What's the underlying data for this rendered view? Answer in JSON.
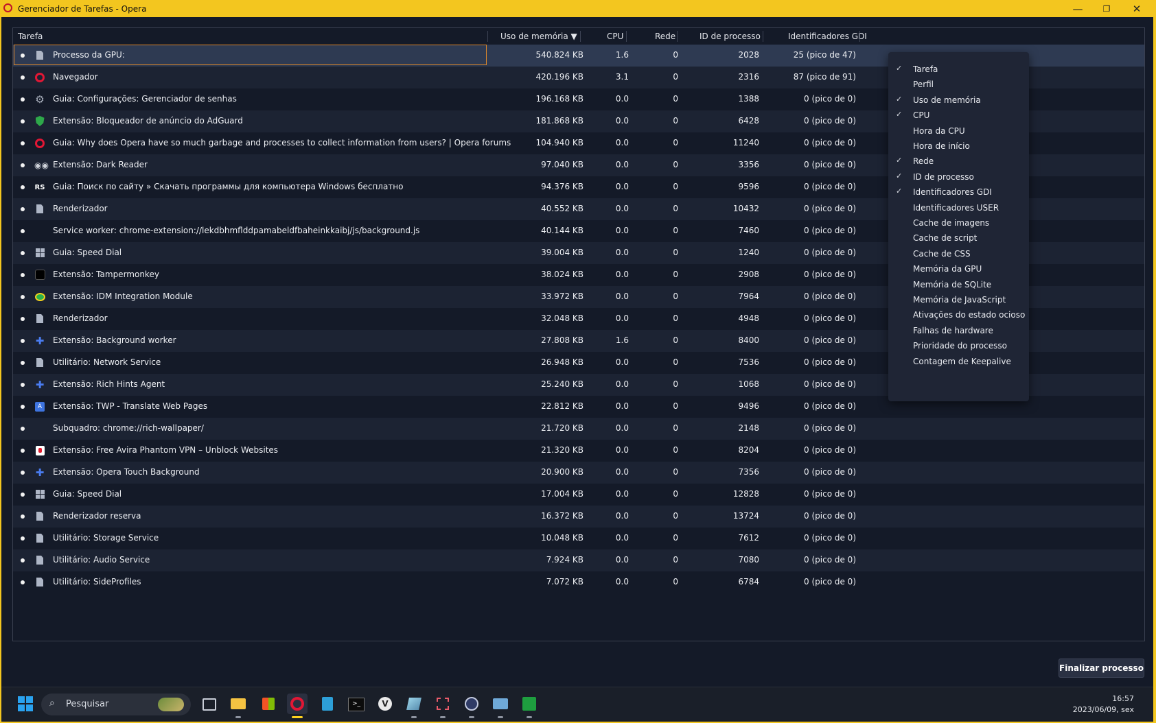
{
  "window": {
    "title": "Gerenciador de Tarefas - Opera",
    "controls": [
      "—",
      "❐",
      "✕"
    ]
  },
  "table": {
    "headers": {
      "task": "Tarefa",
      "memory": "Uso de memória ▼",
      "cpu": "CPU",
      "network": "Rede",
      "pid": "ID de processo",
      "gdi": "Identificadores GDI"
    },
    "rows": [
      {
        "icon": "doc-icon",
        "name": "Processo da GPU:",
        "mem": "540.824 KB",
        "cpu": "1.6",
        "net": "0",
        "pid": "2028",
        "gdi": "25 (pico de 47)",
        "selected": true
      },
      {
        "icon": "opera-icon",
        "name": "Navegador",
        "mem": "420.196 KB",
        "cpu": "3.1",
        "net": "0",
        "pid": "2316",
        "gdi": "87 (pico de 91)"
      },
      {
        "icon": "gear-icon",
        "name": "Guia: Configurações: Gerenciador de senhas",
        "mem": "196.168 KB",
        "cpu": "0.0",
        "net": "0",
        "pid": "1388",
        "gdi": "0 (pico de 0)"
      },
      {
        "icon": "shield-icon",
        "name": "Extensão: Bloqueador de anúncio do AdGuard",
        "mem": "181.868 KB",
        "cpu": "0.0",
        "net": "0",
        "pid": "6428",
        "gdi": "0 (pico de 0)"
      },
      {
        "icon": "opera-icon",
        "name": "Guia: Why does Opera have so much garbage and processes to collect information from users? | Opera forums",
        "mem": "104.940 KB",
        "cpu": "0.0",
        "net": "0",
        "pid": "11240",
        "gdi": "0 (pico de 0)"
      },
      {
        "icon": "dark-reader-icon",
        "name": "Extensão: Dark Reader",
        "mem": "97.040 KB",
        "cpu": "0.0",
        "net": "0",
        "pid": "3356",
        "gdi": "0 (pico de 0)"
      },
      {
        "icon": "rs-icon",
        "name": "Guia: Поиск по сайту » Скачать программы для компьютера Windows бесплатно",
        "mem": "94.376 KB",
        "cpu": "0.0",
        "net": "0",
        "pid": "9596",
        "gdi": "0 (pico de 0)"
      },
      {
        "icon": "doc-icon",
        "name": "Renderizador",
        "mem": "40.552 KB",
        "cpu": "0.0",
        "net": "0",
        "pid": "10432",
        "gdi": "0 (pico de 0)"
      },
      {
        "icon": "none",
        "name": "Service worker: chrome-extension://lekdbhmflddpamabeldfbaheinkkaibj/js/background.js",
        "mem": "40.144 KB",
        "cpu": "0.0",
        "net": "0",
        "pid": "7460",
        "gdi": "0 (pico de 0)"
      },
      {
        "icon": "grid-icon",
        "name": "Guia: Speed Dial",
        "mem": "39.004 KB",
        "cpu": "0.0",
        "net": "0",
        "pid": "1240",
        "gdi": "0 (pico de 0)"
      },
      {
        "icon": "tampermonkey-icon",
        "name": "Extensão: Tampermonkey",
        "mem": "38.024 KB",
        "cpu": "0.0",
        "net": "0",
        "pid": "2908",
        "gdi": "0 (pico de 0)"
      },
      {
        "icon": "idm-icon",
        "name": "Extensão: IDM Integration Module",
        "mem": "33.972 KB",
        "cpu": "0.0",
        "net": "0",
        "pid": "7964",
        "gdi": "0 (pico de 0)"
      },
      {
        "icon": "doc-icon",
        "name": "Renderizador",
        "mem": "32.048 KB",
        "cpu": "0.0",
        "net": "0",
        "pid": "4948",
        "gdi": "0 (pico de 0)"
      },
      {
        "icon": "puzzle-icon",
        "name": "Extensão: Background worker",
        "mem": "27.808 KB",
        "cpu": "1.6",
        "net": "0",
        "pid": "8400",
        "gdi": "0 (pico de 0)"
      },
      {
        "icon": "doc-icon",
        "name": "Utilitário: Network Service",
        "mem": "26.948 KB",
        "cpu": "0.0",
        "net": "0",
        "pid": "7536",
        "gdi": "0 (pico de 0)"
      },
      {
        "icon": "puzzle-icon",
        "name": "Extensão: Rich Hints Agent",
        "mem": "25.240 KB",
        "cpu": "0.0",
        "net": "0",
        "pid": "1068",
        "gdi": "0 (pico de 0)"
      },
      {
        "icon": "translate-icon",
        "name": "Extensão: TWP - Translate Web Pages",
        "mem": "22.812 KB",
        "cpu": "0.0",
        "net": "0",
        "pid": "9496",
        "gdi": "0 (pico de 0)"
      },
      {
        "icon": "none",
        "name": "Subquadro: chrome://rich-wallpaper/",
        "mem": "21.720 KB",
        "cpu": "0.0",
        "net": "0",
        "pid": "2148",
        "gdi": "0 (pico de 0)"
      },
      {
        "icon": "vpn-icon",
        "name": "Extensão: Free Avira Phantom VPN – Unblock Websites",
        "mem": "21.320 KB",
        "cpu": "0.0",
        "net": "0",
        "pid": "8204",
        "gdi": "0 (pico de 0)"
      },
      {
        "icon": "puzzle-icon",
        "name": "Extensão: Opera Touch Background",
        "mem": "20.900 KB",
        "cpu": "0.0",
        "net": "0",
        "pid": "7356",
        "gdi": "0 (pico de 0)"
      },
      {
        "icon": "grid-icon",
        "name": "Guia: Speed Dial",
        "mem": "17.004 KB",
        "cpu": "0.0",
        "net": "0",
        "pid": "12828",
        "gdi": "0 (pico de 0)"
      },
      {
        "icon": "doc-icon",
        "name": "Renderizador reserva",
        "mem": "16.372 KB",
        "cpu": "0.0",
        "net": "0",
        "pid": "13724",
        "gdi": "0 (pico de 0)"
      },
      {
        "icon": "doc-icon",
        "name": "Utilitário: Storage Service",
        "mem": "10.048 KB",
        "cpu": "0.0",
        "net": "0",
        "pid": "7612",
        "gdi": "0 (pico de 0)"
      },
      {
        "icon": "doc-icon",
        "name": "Utilitário: Audio Service",
        "mem": "7.924 KB",
        "cpu": "0.0",
        "net": "0",
        "pid": "7080",
        "gdi": "0 (pico de 0)"
      },
      {
        "icon": "doc-icon",
        "name": "Utilitário: SideProfiles",
        "mem": "7.072 KB",
        "cpu": "0.0",
        "net": "0",
        "pid": "6784",
        "gdi": "0 (pico de 0)"
      }
    ]
  },
  "column_menu": {
    "items": [
      {
        "label": "Tarefa",
        "checked": true
      },
      {
        "label": "Perfil",
        "checked": false
      },
      {
        "label": "Uso de memória",
        "checked": true
      },
      {
        "label": "CPU",
        "checked": true
      },
      {
        "label": "Hora da CPU",
        "checked": false
      },
      {
        "label": "Hora de início",
        "checked": false
      },
      {
        "label": "Rede",
        "checked": true
      },
      {
        "label": "ID de processo",
        "checked": true
      },
      {
        "label": "Identificadores GDI",
        "checked": true
      },
      {
        "label": "Identificadores USER",
        "checked": false
      },
      {
        "label": "Cache de imagens",
        "checked": false
      },
      {
        "label": "Cache de script",
        "checked": false
      },
      {
        "label": "Cache de CSS",
        "checked": false
      },
      {
        "label": "Memória da GPU",
        "checked": false
      },
      {
        "label": "Memória de SQLite",
        "checked": false
      },
      {
        "label": "Memória de JavaScript",
        "checked": false
      },
      {
        "label": "Ativações do estado ocioso",
        "checked": false
      },
      {
        "label": "Falhas de hardware",
        "checked": false
      },
      {
        "label": "Prioridade do processo",
        "checked": false
      },
      {
        "label": "Contagem de Keepalive",
        "checked": false
      }
    ]
  },
  "end_process_button": "Finalizar processo",
  "taskbar": {
    "search_placeholder": "Pesquisar",
    "time": "16:57",
    "date": "2023/06/09, sex",
    "apps": [
      "windows-start-icon",
      "task-view-icon",
      "file-explorer-icon",
      "microsoft-store-icon",
      "opera-icon",
      "notepad-icon",
      "terminal-icon",
      "vivaldi-icon",
      "app-icon",
      "snipping-tool-icon",
      "vpn-lock-icon",
      "monitor-icon",
      "chart-app-icon"
    ]
  },
  "colors": {
    "window_border": "#f3c61f",
    "background": "#141a28",
    "selected_row": "#2e3a52",
    "focus_outline": "#e0892b",
    "menu_background": "#1f2535"
  }
}
